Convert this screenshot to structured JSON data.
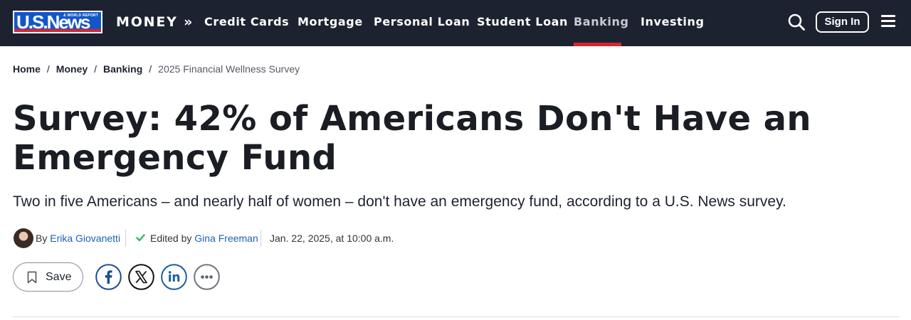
{
  "nav": {
    "logo_text": "U.S.News",
    "logo_sub": "& WORLD REPORT",
    "section": "MONEY »",
    "items": [
      {
        "label": "Credit Cards",
        "active": false
      },
      {
        "label": "Mortgage",
        "active": false
      },
      {
        "label": "Personal Loan",
        "active": false
      },
      {
        "label": "Student Loan",
        "active": false
      },
      {
        "label": "Banking",
        "active": true
      },
      {
        "label": "Investing",
        "active": false
      }
    ],
    "sign_in": "Sign In",
    "search_icon": "search-icon",
    "menu_icon": "hamburger-menu-icon",
    "colors": {
      "bar": "#1d2230",
      "accent": "#d8262d",
      "logo_blue": "#1357c7"
    }
  },
  "breadcrumb": {
    "items": [
      "Home",
      "Money",
      "Banking"
    ],
    "separator": "/",
    "current": "2025 Financial Wellness Survey"
  },
  "article": {
    "title": "Survey: 42% of Americans Don't Have an Emergency Fund",
    "dek": "Two in five Americans – and nearly half of women – don't have an emergency fund, according to a U.S. News survey.",
    "by_prefix": "By",
    "author": "Erika Giovanetti",
    "edited_prefix": "Edited by",
    "editor": "Gina Freeman",
    "date": "Jan. 22, 2025, at 10:00 a.m.",
    "link_color": "#1a62b8"
  },
  "actions": {
    "save_label": "Save",
    "share_icons": [
      "facebook-icon",
      "x-twitter-icon",
      "linkedin-icon",
      "more-options-icon"
    ]
  }
}
